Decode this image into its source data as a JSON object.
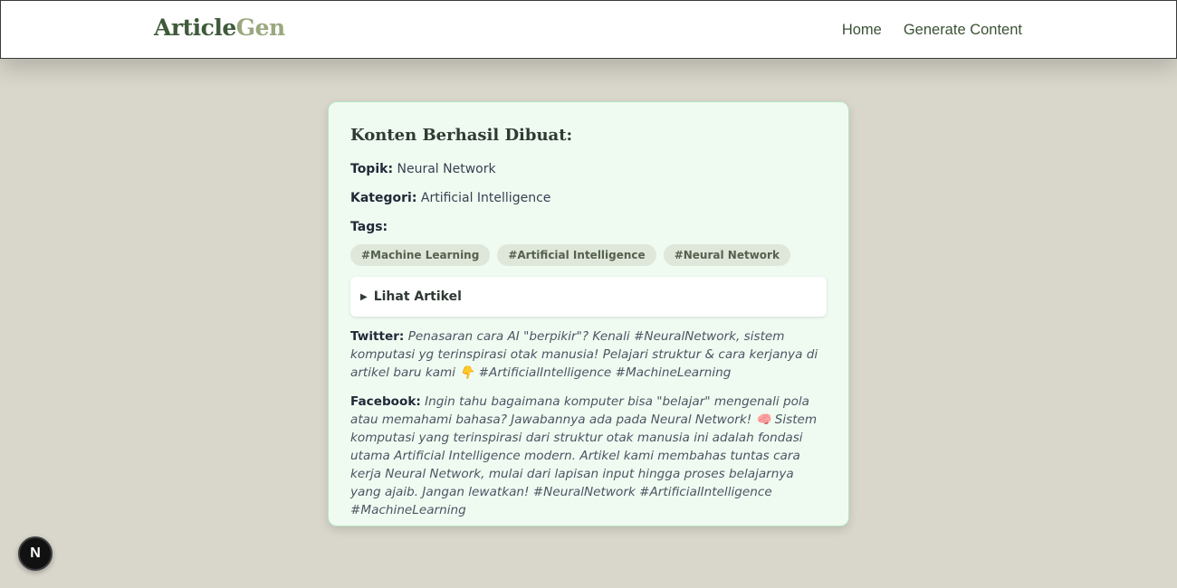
{
  "navbar": {
    "brand_part1": "Article",
    "brand_part2": "Gen",
    "links": [
      "Home",
      "Generate Content"
    ]
  },
  "result": {
    "heading": "Konten Berhasil Dibuat:",
    "topic_label": "Topik:",
    "topic_value": "Neural Network",
    "category_label": "Kategori:",
    "category_value": "Artificial Intelligence",
    "tags_label": "Tags:",
    "tags": [
      "#Machine Learning",
      "#Artificial Intelligence",
      "#Neural Network"
    ],
    "details_label": "Lihat Artikel",
    "twitter_label": "Twitter:",
    "twitter_text": "Penasaran cara AI \"berpikir\"? Kenali #NeuralNetwork, sistem komputasi yg terinspirasi otak manusia! Pelajari struktur & cara kerjanya di artikel baru kami 👇 #ArtificialIntelligence #MachineLearning",
    "facebook_label": "Facebook:",
    "facebook_text": "Ingin tahu bagaimana komputer bisa \"belajar\" mengenali pola atau memahami bahasa? Jawabannya ada pada Neural Network! 🧠 Sistem komputasi yang terinspirasi dari struktur otak manusia ini adalah fondasi utama Artificial Intelligence modern. Artikel kami membahas tuntas cara kerja Neural Network, mulai dari lapisan input hingga proses belajarnya yang ajaib. Jangan lewatkan! #NeuralNetwork #ArtificialIntelligence #MachineLearning"
  },
  "dev_badge": "N",
  "colors": {
    "page_bg": "#d9d6cb",
    "card_bg": "#effbf1",
    "brand_dark": "#3f5a3a",
    "brand_light": "#9aa87f"
  }
}
